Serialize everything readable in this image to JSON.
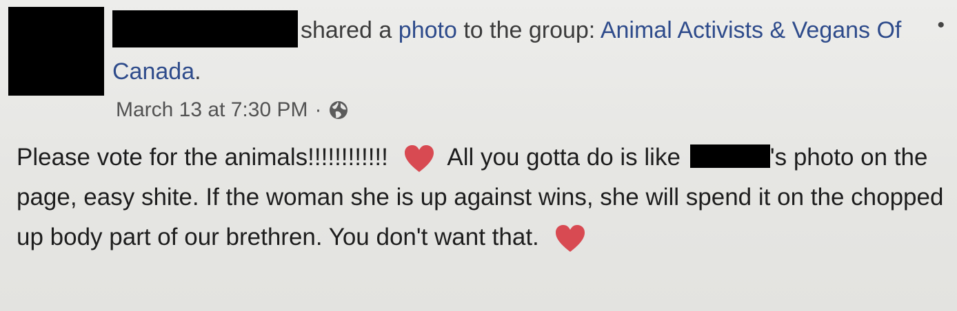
{
  "post": {
    "action_text": "shared a",
    "photo_link": "photo",
    "to_group_text": "to the group:",
    "group_name": "Animal Activists & Vegans Of Canada",
    "group_suffix": ".",
    "timestamp": "March 13 at 7:30 PM",
    "separator": "·",
    "privacy_icon": "globe-icon",
    "more_icon": "•",
    "body_part1": "Please vote for the animals!!!!!!!!!!!!",
    "body_part2": "All you gotta do is like",
    "body_part3": "'s photo on the page, easy shite. If the woman she is up against wins, she will spend it on the chopped up body part of our brethren. You don't want that.",
    "heart_icon": "heart-icon"
  },
  "colors": {
    "background": "#e9e9e7",
    "link": "#2e4b8b",
    "heart": "#d84a52",
    "redaction": "#000000"
  }
}
